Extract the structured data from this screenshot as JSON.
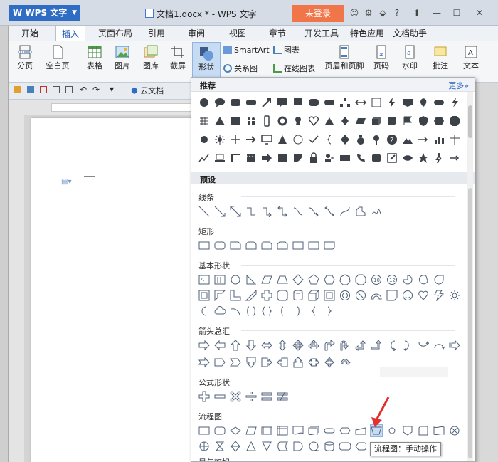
{
  "titlebar": {
    "app_name": "WPS 文字",
    "doc_title": "文档1.docx * - WPS 文字",
    "login": "未登录"
  },
  "menu": [
    {
      "label": "开始"
    },
    {
      "label": "插入",
      "active": true
    },
    {
      "label": "页面布局"
    },
    {
      "label": "引用"
    },
    {
      "label": "审阅"
    },
    {
      "label": "视图"
    },
    {
      "label": "章节"
    },
    {
      "label": "开发工具"
    },
    {
      "label": "特色应用"
    },
    {
      "label": "文档助手"
    }
  ],
  "ribbon": {
    "page_break": "分页",
    "blank_page": "空白页",
    "table": "表格",
    "picture": "图片",
    "gallery": "图库",
    "screenshot": "截屏",
    "shapes": "形状",
    "smartart": "SmartArt",
    "chart": "图表",
    "relation": "关系图",
    "online_chart": "在线图表",
    "header_footer": "页眉和页脚",
    "page_number": "页码",
    "watermark": "水印",
    "comment": "批注",
    "textbox": "文本"
  },
  "quickbar": {
    "cloud_doc": "云文档"
  },
  "panel": {
    "recommended": "推荐",
    "more": "更多",
    "preset": "预设",
    "categories": {
      "lines": "线条",
      "rect": "矩形",
      "basic": "基本形状",
      "arrows": "箭头总汇",
      "formula": "公式形状",
      "flowchart": "流程图",
      "stars": "星与旗帜"
    },
    "tooltip": "流程图：手动操作"
  },
  "colors": {
    "accent": "#2f6cc4",
    "login": "#f0764a",
    "shape_fill": "#3d4148",
    "outline": "#4f5f78",
    "arrow": "#e03030"
  }
}
